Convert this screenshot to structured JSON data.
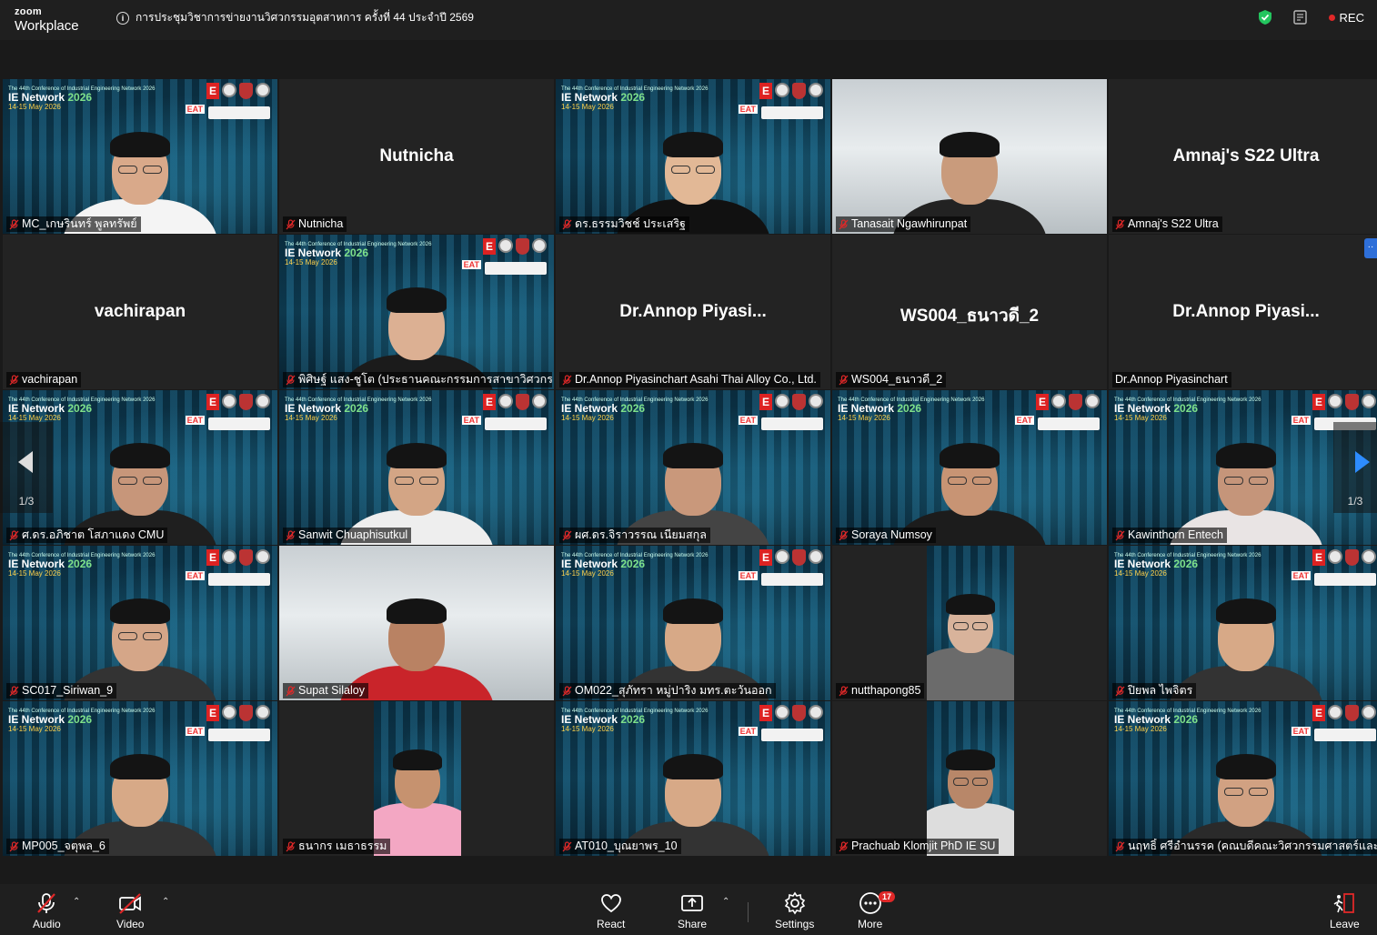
{
  "app": {
    "brand_top": "zoom",
    "brand_bottom": "Workplace"
  },
  "meeting": {
    "title": "การประชุมวิชาการข่ายงานวิศวกรรมอุตสาหการ ครั้งที่ 44 ประจำปี 2569",
    "rec_label": "REC"
  },
  "conference_bg": {
    "small": "The 44th Conference of Industrial Engineering Network 2026",
    "title_a": "IE Network ",
    "title_b": "2026",
    "date": "14-15 May 2026",
    "eat": "EAT"
  },
  "tiles": [
    {
      "label": "MC_เกษรินทร์ พูลทรัพย์",
      "big": ""
    },
    {
      "label": "Nutnicha",
      "big": "Nutnicha"
    },
    {
      "label": "ดร.ธรรมวิชช์ ประเสริฐ",
      "big": ""
    },
    {
      "label": "Tanasait Ngawhirunpat",
      "big": ""
    },
    {
      "label": "Amnaj's S22 Ultra",
      "big": "Amnaj's S22 Ultra"
    },
    {
      "label": "vachirapan",
      "big": "vachirapan"
    },
    {
      "label": "พิศิษฐ์ แสง-ชูโต (ประธานคณะกรรมการสาขาวิศวกรรม...",
      "big": ""
    },
    {
      "label": "Dr.Annop Piyasinchart Asahi Thai Alloy Co., Ltd.",
      "big": "Dr.Annop  Piyasi..."
    },
    {
      "label": "WS004_ธนาวดี_2",
      "big": "WS004_ธนาวดี_2"
    },
    {
      "label": "Dr.Annop Piyasinchart",
      "big": "Dr.Annop  Piyasi..."
    },
    {
      "label": "ศ.ดร.อภิชาต โสภาแดง CMU",
      "big": ""
    },
    {
      "label": "Sanwit Chuaphisutkul",
      "big": ""
    },
    {
      "label": "ผศ.ดร.จิราวรรณ เนียมสกุล",
      "big": ""
    },
    {
      "label": "Soraya Numsoy",
      "big": ""
    },
    {
      "label": "Kawinthorn Entech",
      "big": ""
    },
    {
      "label": "SC017_Siriwan_9",
      "big": ""
    },
    {
      "label": "Supat Silaloy",
      "big": ""
    },
    {
      "label": "OM022_สุภัทรา หมู่ปาริง มทร.ตะวันออก",
      "big": ""
    },
    {
      "label": "nutthapong85",
      "big": ""
    },
    {
      "label": "ปิยพล ไพจิตร",
      "big": ""
    },
    {
      "label": "MP005_จตุพล_6",
      "big": ""
    },
    {
      "label": "ธนากร เมธาธรรม",
      "big": ""
    },
    {
      "label": "AT010_บุณยาพร_10",
      "big": ""
    },
    {
      "label": "Prachuab Klomjit PhD IE SU",
      "big": ""
    },
    {
      "label": "นฤทธิ์ ศรีอำนรรค (คณบดีคณะวิศวกรรมศาสตร์และเทคโนโล...",
      "big": ""
    }
  ],
  "pagination": {
    "left": "1/3",
    "right": "1/3"
  },
  "toolbar": {
    "audio": "Audio",
    "video": "Video",
    "react": "React",
    "share": "Share",
    "settings": "Settings",
    "more": "More",
    "more_badge": "17",
    "leave": "Leave"
  },
  "colors": {
    "active_speaker": "#23d96b",
    "rec": "#e02828",
    "mic_off": "#e02828",
    "leave": "#e02828"
  }
}
